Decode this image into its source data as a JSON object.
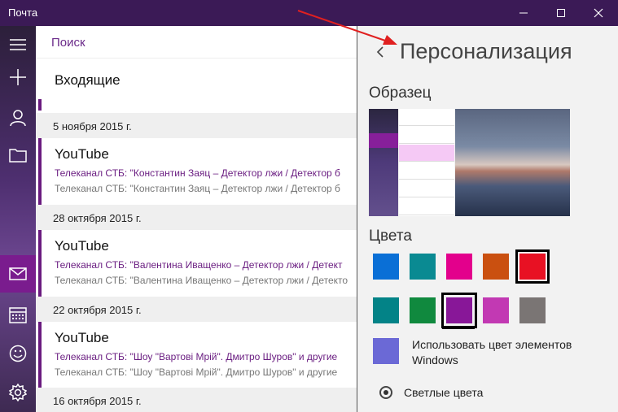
{
  "window": {
    "title": "Почта"
  },
  "rail": {
    "items": [
      "hamburger-icon",
      "plus-icon",
      "person-icon",
      "folder-icon",
      "mail-icon",
      "calendar-icon",
      "smiley-icon",
      "gear-icon"
    ]
  },
  "search": {
    "label": "Поиск"
  },
  "inbox": {
    "title": "Входящие"
  },
  "groups": [
    {
      "date": "5 ноября 2015 г.",
      "sender": "YouTube",
      "subject": "Телеканал СТБ: \"Константин Заяц – Детектор лжи / Детектор б",
      "preview": "Телеканал СТБ: \"Константин Заяц – Детектор лжи / Детектор б"
    },
    {
      "date": "28 октября 2015 г.",
      "sender": "YouTube",
      "subject": "Телеканал СТБ: \"Валентина Иващенко – Детектор лжи / Детект",
      "preview": "Телеканал СТБ: \"Валентина Иващенко – Детектор лжи / Детекто"
    },
    {
      "date": "22 октября 2015 г.",
      "sender": "YouTube",
      "subject": "Телеканал СТБ: \"Шоу \"Вартові Мрій\". Дмитро Шуров\" и другие",
      "preview": "Телеканал СТБ: \"Шоу \"Вартові Мрій\". Дмитро Шуров\" и другие"
    },
    {
      "date": "16 октября 2015 г."
    }
  ],
  "panel": {
    "title": "Персонализация",
    "sample_heading": "Образец",
    "colors_heading": "Цвета",
    "swatches_row1": [
      "#0a6fd6",
      "#0a8a92",
      "#e3008c",
      "#ca5010",
      "#e81123"
    ],
    "swatches_row2": [
      "#038387",
      "#10893e",
      "#881798",
      "#c239b3",
      "#7a7574"
    ],
    "selected_row2_index": 2,
    "windows_color": "#6b69d6",
    "use_windows_color_label": "Использовать цвет элементов Windows",
    "light_colors_label": "Светлые цвета"
  },
  "colors": {
    "accent": "#7a1c8e",
    "titlebar": "#3b1a56",
    "annotation_arrow": "#e02020"
  }
}
